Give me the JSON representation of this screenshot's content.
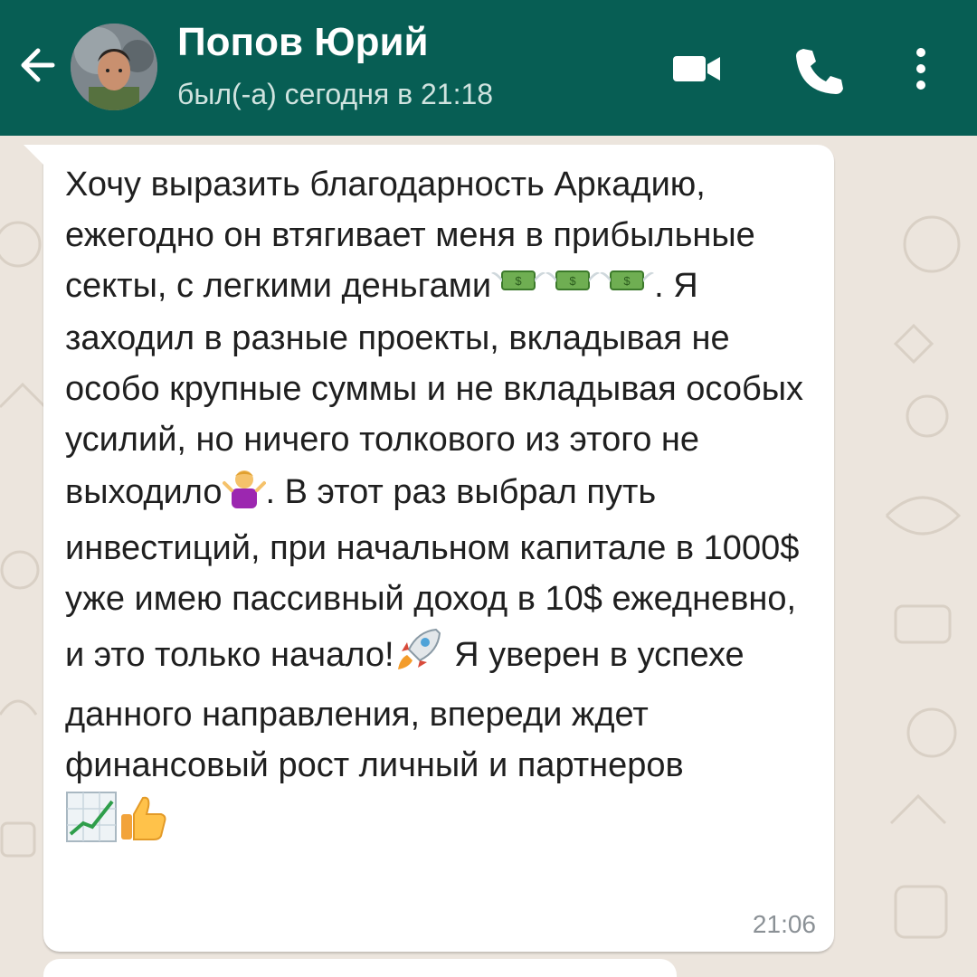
{
  "header": {
    "contact_name": "Попов Юрий",
    "status": "был(-а) сегодня в 21:18",
    "bar_color": "#075E54"
  },
  "message": {
    "segments": [
      "Хочу выразить благодарность Аркадию, ежегодно он втягивает меня в прибыльные секты, с легкими деньгами",
      ". Я заходил в разные проекты, вкладывая не особо крупные суммы и не вкладывая особых усилий, но ничего толкового из этого не выходило",
      ". В этот раз выбрал путь инвестиций, при начальном капитале в 1000$ уже имею пассивный доход в 10$ ежедневно, и это только начало!",
      " Я уверен в успехе данного направления, впереди ждет финансовый рост личный и партнеров"
    ],
    "emojis": [
      "money-with-wings",
      "money-with-wings",
      "money-with-wings",
      "person-shrugging",
      "rocket",
      "chart-increasing",
      "thumbs-up"
    ],
    "time": "21:06",
    "bubble_color": "#FFFFFF"
  }
}
